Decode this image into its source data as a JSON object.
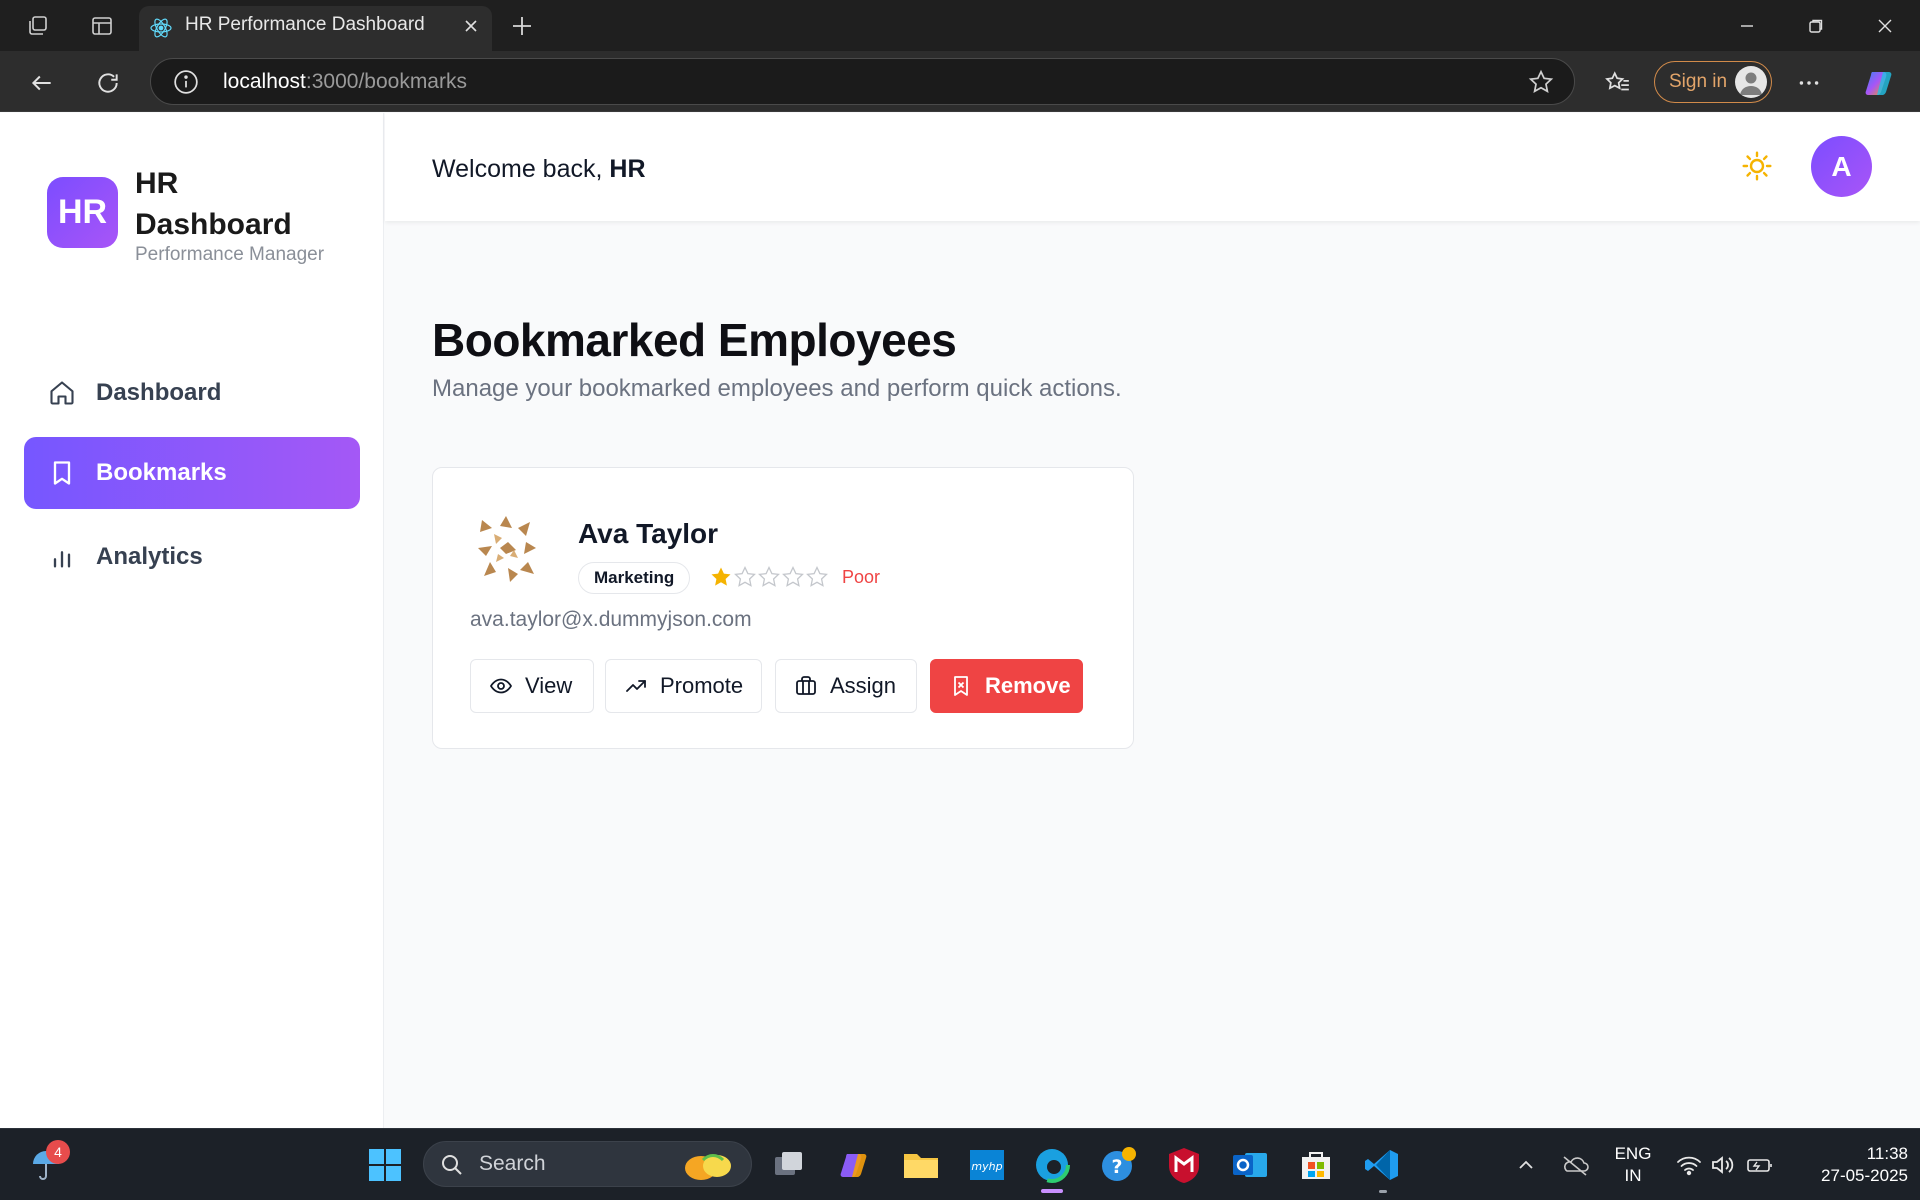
{
  "browser": {
    "tab_title": "HR Performance Dashboard",
    "url_host": "localhost",
    "url_path": ":3000/bookmarks",
    "signin_label": "Sign in"
  },
  "app": {
    "logo_initials": "HR",
    "logo_title": "HR Dashboard",
    "logo_subtitle": "Performance Manager",
    "nav": [
      {
        "label": "Dashboard",
        "icon": "home-icon",
        "active": false
      },
      {
        "label": "Bookmarks",
        "icon": "bookmark-icon",
        "active": true
      },
      {
        "label": "Analytics",
        "icon": "bar-chart-icon",
        "active": false
      }
    ],
    "header": {
      "welcome_prefix": "Welcome back, ",
      "welcome_name": "HR",
      "avatar_initial": "A"
    },
    "page": {
      "title": "Bookmarked Employees",
      "subtitle": "Manage your bookmarked employees and perform quick actions."
    },
    "employee": {
      "name": "Ava Taylor",
      "department": "Marketing",
      "rating": 1,
      "rating_max": 5,
      "rating_label": "Poor",
      "email": "ava.taylor@x.dummyjson.com"
    },
    "actions": {
      "view": "View",
      "promote": "Promote",
      "assign": "Assign",
      "remove": "Remove"
    },
    "colors": {
      "accent_start": "#7657ff",
      "accent_end": "#a458f6",
      "danger": "#ef4444",
      "star": "#f5b301"
    }
  },
  "taskbar": {
    "search_label": "Search",
    "weather_badge": "4",
    "lang_line1": "ENG",
    "lang_line2": "IN",
    "time": "11:38",
    "date": "27-05-2025"
  }
}
